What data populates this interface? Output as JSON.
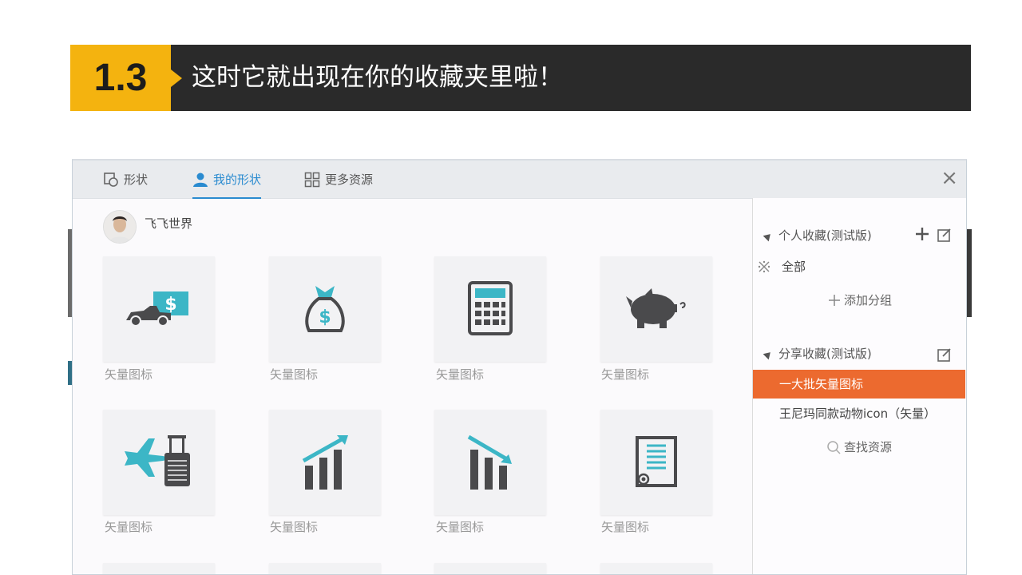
{
  "banner": {
    "number": "1.3",
    "title": "这时它就出现在你的收藏夹里啦！"
  },
  "tabs": [
    {
      "label": "形状",
      "icon": "shape-icon",
      "active": false
    },
    {
      "label": "我的形状",
      "icon": "user-icon",
      "active": true
    },
    {
      "label": "更多资源",
      "icon": "grid-icon",
      "active": false
    }
  ],
  "user": {
    "name": "飞飞世界"
  },
  "shapes": [
    {
      "caption": "矢量图标",
      "icon": "car-money-icon"
    },
    {
      "caption": "矢量图标",
      "icon": "money-bag-icon"
    },
    {
      "caption": "矢量图标",
      "icon": "calculator-icon"
    },
    {
      "caption": "矢量图标",
      "icon": "piggy-bank-icon"
    },
    {
      "caption": "矢量图标",
      "icon": "plane-luggage-icon"
    },
    {
      "caption": "矢量图标",
      "icon": "chart-up-icon"
    },
    {
      "caption": "矢量图标",
      "icon": "chart-down-icon"
    },
    {
      "caption": "矢量图标",
      "icon": "certificate-icon"
    }
  ],
  "panel": {
    "personal": {
      "title": "个人收藏(测试版)",
      "all": "全部",
      "add_group": "添加分组"
    },
    "shared": {
      "title": "分享收藏(测试版)",
      "items": [
        "一大批矢量图标",
        "王尼玛同款动物icon（矢量）"
      ],
      "search": "查找资源"
    }
  },
  "colors": {
    "accent": "#2a8bd0",
    "highlight": "#ec6a2f",
    "banner_yellow": "#f4b30f",
    "icon_teal": "#3cb6c6",
    "icon_gray": "#4a4a4c"
  }
}
